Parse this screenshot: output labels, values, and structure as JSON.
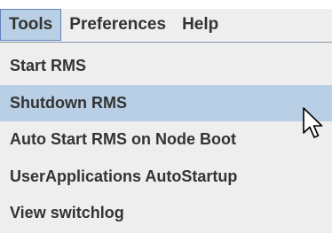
{
  "menubar": {
    "items": [
      {
        "label": "Tools",
        "active": true
      },
      {
        "label": "Preferences",
        "active": false
      },
      {
        "label": "Help",
        "active": false
      }
    ]
  },
  "menu": {
    "items": [
      {
        "label": "Start RMS",
        "highlighted": false
      },
      {
        "label": "Shutdown RMS",
        "highlighted": true
      },
      {
        "label": "Auto Start RMS on Node Boot",
        "highlighted": false
      },
      {
        "label": "UserApplications AutoStartup",
        "highlighted": false
      },
      {
        "label": "View switchlog",
        "highlighted": false
      }
    ]
  },
  "cursor": {
    "icon": "mouse-pointer-icon"
  },
  "colors": {
    "menu_background": "#eeeeee",
    "highlight": "#b8cfe5",
    "active_border": "#6382bf",
    "text": "#333333"
  }
}
